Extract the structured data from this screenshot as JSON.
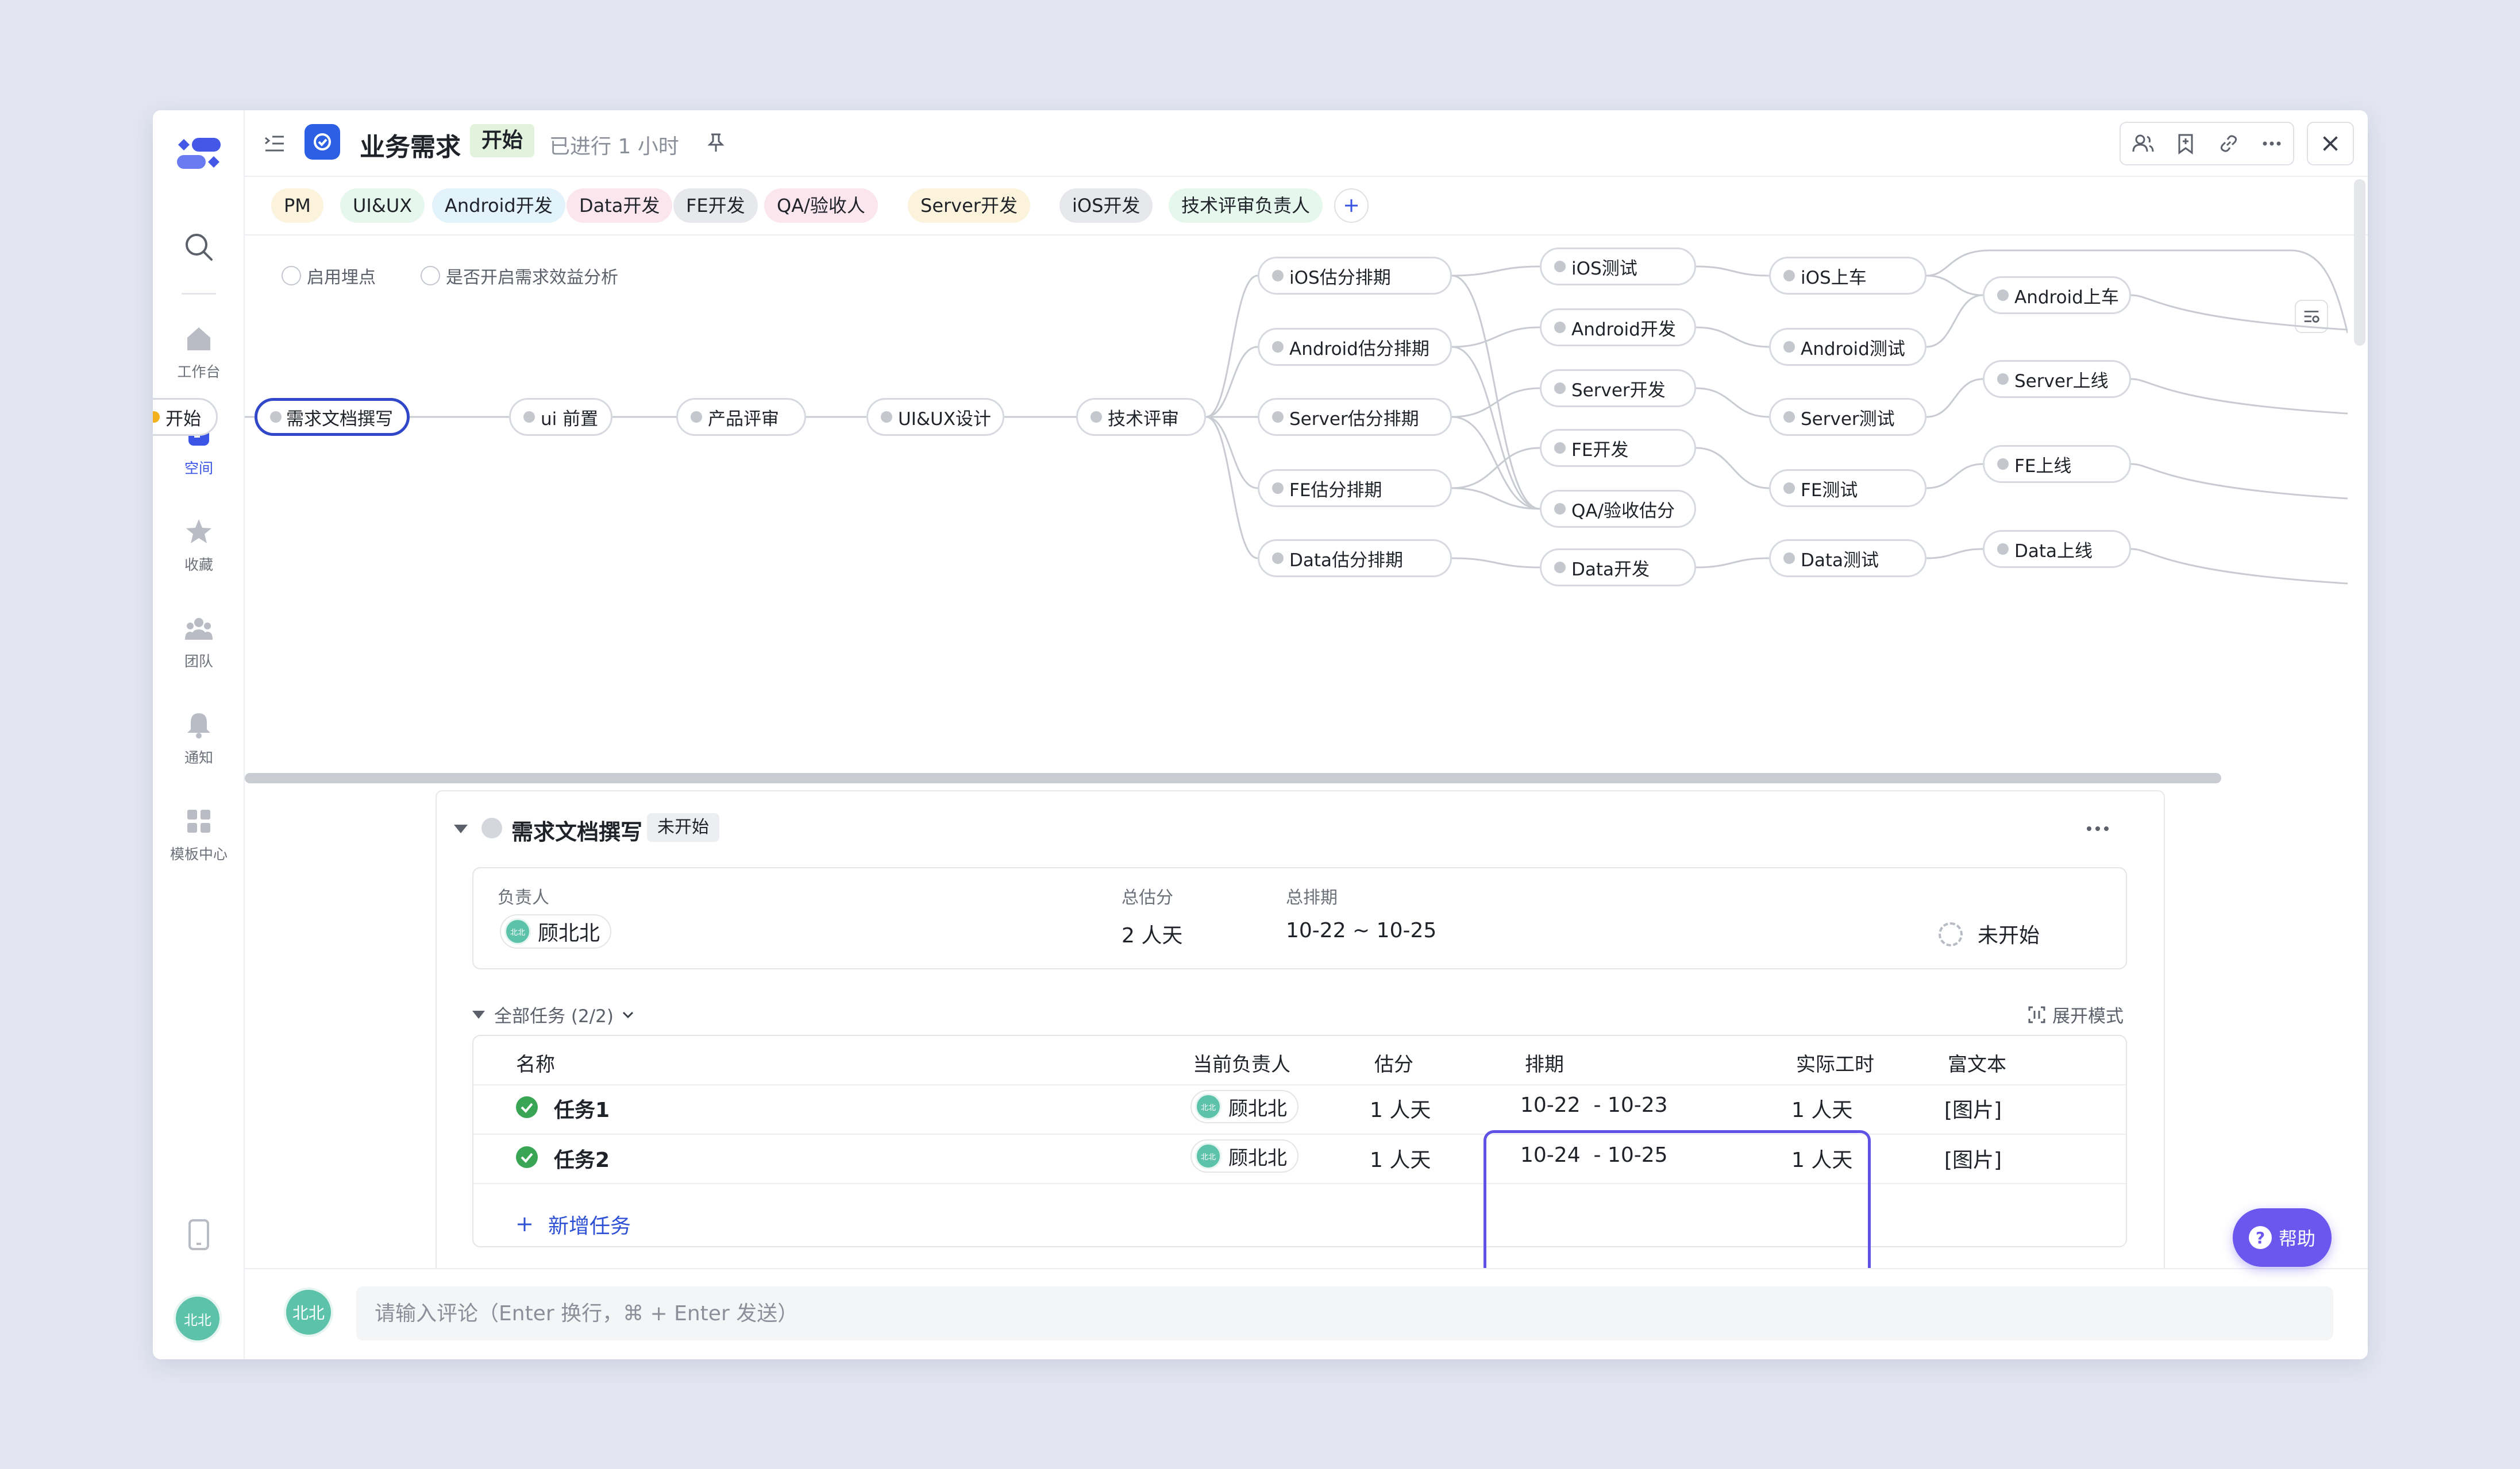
{
  "sidebar": {
    "items": [
      {
        "name": "home",
        "label": "工作台"
      },
      {
        "name": "space",
        "label": "空间"
      },
      {
        "name": "favorites",
        "label": "收藏"
      },
      {
        "name": "team",
        "label": "团队"
      },
      {
        "name": "notifications",
        "label": "通知"
      },
      {
        "name": "templates",
        "label": "模板中心"
      }
    ],
    "active": "space",
    "avatar": "北北"
  },
  "header": {
    "title": "业务需求",
    "stage_badge": "开始",
    "elapsed": "已进行 1 小时"
  },
  "roles": [
    {
      "label": "PM",
      "color": "#fbf3dc"
    },
    {
      "label": "UI&UX",
      "color": "#e6f7ee"
    },
    {
      "label": "Android开发",
      "color": "#e2f3fb"
    },
    {
      "label": "Data开发",
      "color": "#fbe6ee"
    },
    {
      "label": "FE开发",
      "color": "#e6e8ec"
    },
    {
      "label": "QA/验收人",
      "color": "#fbe6ee"
    },
    {
      "label": "Server开发",
      "color": "#fbf3dc"
    },
    {
      "label": "iOS开发",
      "color": "#e6e8ec"
    },
    {
      "label": "技术评审负责人",
      "color": "#e6f7ee"
    }
  ],
  "options": {
    "tracking": "启用埋点",
    "benefit": "是否开启需求效益分析"
  },
  "flow": {
    "nodes": [
      {
        "id": "start",
        "label": "开始"
      },
      {
        "id": "doc",
        "label": "需求文档撰写"
      },
      {
        "id": "ui",
        "label": "ui 前置"
      },
      {
        "id": "review",
        "label": "产品评审"
      },
      {
        "id": "uiux",
        "label": "UI&UX设计"
      },
      {
        "id": "tech",
        "label": "技术评审"
      },
      {
        "id": "ios_est",
        "label": "iOS估分排期"
      },
      {
        "id": "and_est",
        "label": "Android估分排期"
      },
      {
        "id": "srv_est",
        "label": "Server估分排期"
      },
      {
        "id": "fe_est",
        "label": "FE估分排期"
      },
      {
        "id": "data_est",
        "label": "Data估分排期"
      },
      {
        "id": "ios_test",
        "label": "iOS测试"
      },
      {
        "id": "and_dev",
        "label": "Android开发"
      },
      {
        "id": "srv_dev",
        "label": "Server开发"
      },
      {
        "id": "fe_dev",
        "label": "FE开发"
      },
      {
        "id": "qa_est",
        "label": "QA/验收估分"
      },
      {
        "id": "data_dev",
        "label": "Data开发"
      },
      {
        "id": "ios_car",
        "label": "iOS上车"
      },
      {
        "id": "and_test",
        "label": "Android测试"
      },
      {
        "id": "srv_test",
        "label": "Server测试"
      },
      {
        "id": "fe_test",
        "label": "FE测试"
      },
      {
        "id": "data_test",
        "label": "Data测试"
      },
      {
        "id": "and_car",
        "label": "Android上车"
      },
      {
        "id": "srv_live",
        "label": "Server上线"
      },
      {
        "id": "fe_live",
        "label": "FE上线"
      },
      {
        "id": "data_live",
        "label": "Data上线"
      }
    ],
    "selected": "doc"
  },
  "panel": {
    "title": "需求文档撰写",
    "status_badge": "未开始",
    "summary": {
      "owner_label": "负责人",
      "owner": "顾北北",
      "owner_avatar": "北北",
      "estimate_label": "总估分",
      "estimate": "2 人天",
      "schedule_label": "总排期",
      "schedule": "10-22 ~ 10-25",
      "status": "未开始"
    },
    "tasks_header": "全部任务 (2/2)",
    "expand_mode": "展开模式",
    "columns": {
      "name": "名称",
      "assignee": "当前负责人",
      "estimate": "估分",
      "schedule": "排期",
      "actual": "实际工时",
      "richtext": "富文本"
    },
    "tasks": [
      {
        "name": "任务1",
        "assignee": "顾北北",
        "avatar": "北北",
        "estimate": "1 人天",
        "schedule": "10-22  - 10-23",
        "actual": "1 人天",
        "richtext": "[图片]"
      },
      {
        "name": "任务2",
        "assignee": "顾北北",
        "avatar": "北北",
        "estimate": "1 人天",
        "schedule": "10-24  - 10-25",
        "actual": "1 人天",
        "richtext": "[图片]"
      }
    ],
    "add_task": "新增任务"
  },
  "comment": {
    "avatar": "北北",
    "placeholder": "请输入评论（Enter 换行，⌘ + Enter 发送）"
  },
  "help": {
    "label": "帮助"
  }
}
